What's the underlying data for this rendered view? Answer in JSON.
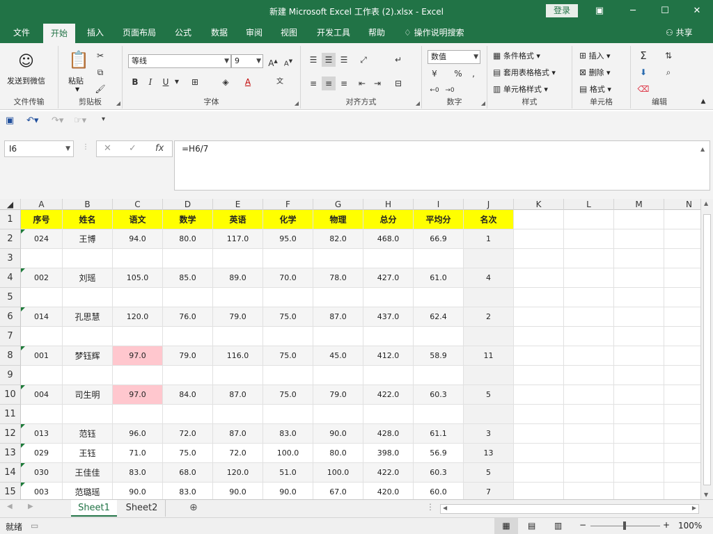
{
  "window": {
    "title": "新建 Microsoft Excel 工作表 (2).xlsx  -  Excel",
    "login": "登录"
  },
  "tabs": [
    "文件",
    "开始",
    "插入",
    "页面布局",
    "公式",
    "数据",
    "审阅",
    "视图",
    "开发工具",
    "帮助"
  ],
  "tell_me": "操作说明搜索",
  "share": "共享",
  "ribbon": {
    "wechat": "发送到微信",
    "paste": "粘贴",
    "font_name": "等线",
    "font_size": "9",
    "number_format": "数值",
    "number_percent": "%",
    "number_comma": ",",
    "cond_format": "条件格式",
    "table_format": "套用表格格式",
    "cell_style": "单元格样式",
    "insert": "插入",
    "delete": "删除",
    "format": "格式",
    "bold": "B",
    "italic": "I",
    "underline": "U",
    "groups": {
      "file_transfer": "文件传输",
      "clipboard": "剪贴板",
      "font": "字体",
      "alignment": "对齐方式",
      "number": "数字",
      "styles": "样式",
      "cells": "单元格",
      "editing": "编辑"
    }
  },
  "formula_bar": {
    "name_box": "I6",
    "formula": "=H6/7"
  },
  "columns": [
    "A",
    "B",
    "C",
    "D",
    "E",
    "F",
    "G",
    "H",
    "I",
    "J",
    "K",
    "L",
    "M",
    "N"
  ],
  "rows": [
    "1",
    "2",
    "3",
    "4",
    "5",
    "6",
    "7",
    "8",
    "9",
    "10",
    "11",
    "12",
    "13",
    "14",
    "15"
  ],
  "table": {
    "headers": [
      "序号",
      "姓名",
      "语文",
      "数学",
      "英语",
      "化学",
      "物理",
      "总分",
      "平均分",
      "名次"
    ],
    "data": [
      [
        "024",
        "王博",
        "94.0",
        "80.0",
        "117.0",
        "95.0",
        "82.0",
        "468.0",
        "66.9",
        "1"
      ],
      [
        "",
        "",
        "",
        "",
        "",
        "",
        "",
        "",
        "",
        ""
      ],
      [
        "002",
        "刘瑶",
        "105.0",
        "85.0",
        "89.0",
        "70.0",
        "78.0",
        "427.0",
        "61.0",
        "4"
      ],
      [
        "",
        "",
        "",
        "",
        "",
        "",
        "",
        "",
        "",
        ""
      ],
      [
        "014",
        "孔思慧",
        "120.0",
        "76.0",
        "79.0",
        "75.0",
        "87.0",
        "437.0",
        "62.4",
        "2"
      ],
      [
        "",
        "",
        "",
        "",
        "",
        "",
        "",
        "",
        "",
        ""
      ],
      [
        "001",
        "梦钰辉",
        "97.0",
        "79.0",
        "116.0",
        "75.0",
        "45.0",
        "412.0",
        "58.9",
        "11"
      ],
      [
        "",
        "",
        "",
        "",
        "",
        "",
        "",
        "",
        "",
        ""
      ],
      [
        "004",
        "司生明",
        "97.0",
        "84.0",
        "87.0",
        "75.0",
        "79.0",
        "422.0",
        "60.3",
        "5"
      ],
      [
        "",
        "",
        "",
        "",
        "",
        "",
        "",
        "",
        "",
        ""
      ],
      [
        "013",
        "范钰",
        "96.0",
        "72.0",
        "87.0",
        "83.0",
        "90.0",
        "428.0",
        "61.1",
        "3"
      ],
      [
        "029",
        "王钰",
        "71.0",
        "75.0",
        "72.0",
        "100.0",
        "80.0",
        "398.0",
        "56.9",
        "13"
      ],
      [
        "030",
        "王佳佳",
        "83.0",
        "68.0",
        "120.0",
        "51.0",
        "100.0",
        "422.0",
        "60.3",
        "5"
      ],
      [
        "003",
        "范璐瑶",
        "90.0",
        "83.0",
        "90.0",
        "90.0",
        "67.0",
        "420.0",
        "60.0",
        "7"
      ]
    ]
  },
  "colors": {
    "accent": "#217346",
    "header_fill": "#ffff00",
    "highlight_fill": "#ffc7ce"
  },
  "sheets": [
    "Sheet1",
    "Sheet2"
  ],
  "status": {
    "ready": "就绪",
    "zoom": "100%"
  }
}
